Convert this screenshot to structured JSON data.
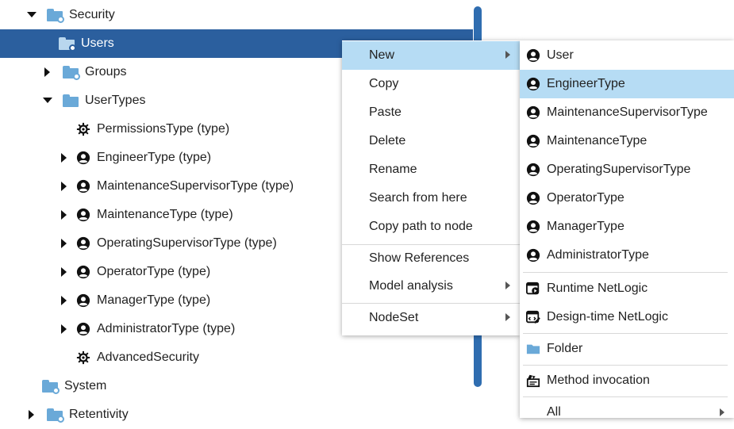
{
  "tree": {
    "items": [
      {
        "label": "Security"
      },
      {
        "label": "Users"
      },
      {
        "label": "Groups"
      },
      {
        "label": "UserTypes"
      },
      {
        "label": "PermissionsType (type)"
      },
      {
        "label": "EngineerType (type)"
      },
      {
        "label": "MaintenanceSupervisorType (type)"
      },
      {
        "label": "MaintenanceType (type)"
      },
      {
        "label": "OperatingSupervisorType (type)"
      },
      {
        "label": "OperatorType (type)"
      },
      {
        "label": "ManagerType (type)"
      },
      {
        "label": "AdministratorType (type)"
      },
      {
        "label": "AdvancedSecurity"
      },
      {
        "label": "System"
      },
      {
        "label": "Retentivity"
      }
    ]
  },
  "context_menu": {
    "items": [
      {
        "label": "New"
      },
      {
        "label": "Copy"
      },
      {
        "label": "Paste"
      },
      {
        "label": "Delete"
      },
      {
        "label": "Rename"
      },
      {
        "label": "Search from here"
      },
      {
        "label": "Copy path to node"
      },
      {
        "label": "Show References"
      },
      {
        "label": "Model analysis"
      },
      {
        "label": "NodeSet"
      }
    ]
  },
  "submenu": {
    "items": [
      {
        "label": "User"
      },
      {
        "label": "EngineerType"
      },
      {
        "label": "MaintenanceSupervisorType"
      },
      {
        "label": "MaintenanceType"
      },
      {
        "label": "OperatingSupervisorType"
      },
      {
        "label": "OperatorType"
      },
      {
        "label": "ManagerType"
      },
      {
        "label": "AdministratorType"
      },
      {
        "label": "Runtime NetLogic"
      },
      {
        "label": "Design-time NetLogic"
      },
      {
        "label": "Folder"
      },
      {
        "label": "Method invocation"
      },
      {
        "label": "All"
      }
    ]
  },
  "colors": {
    "selection": "#2b5f9e",
    "menu_highlight": "#b6dcf4",
    "folder": "#6aa9d8",
    "scrollbar": "#2f6db0"
  }
}
